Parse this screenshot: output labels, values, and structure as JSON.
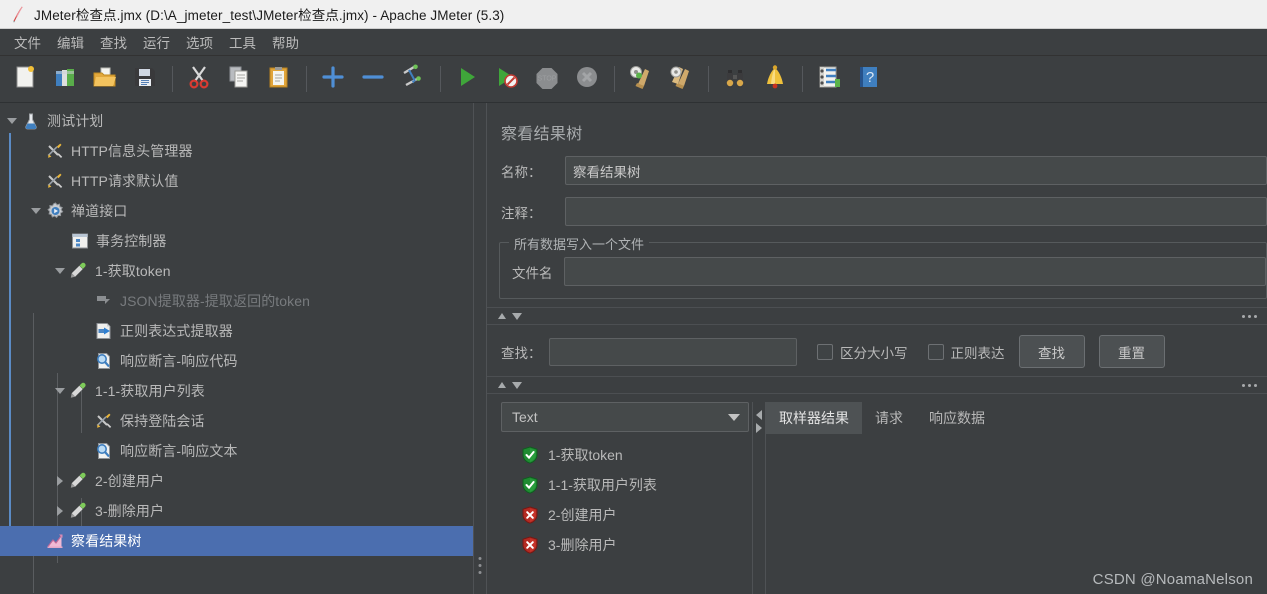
{
  "window": {
    "title": "JMeter检查点.jmx (D:\\A_jmeter_test\\JMeter检查点.jmx) - Apache JMeter (5.3)",
    "app_icon": "jmeter-feather-icon"
  },
  "menubar": {
    "items": [
      {
        "label": "文件",
        "name": "menu-file"
      },
      {
        "label": "编辑",
        "name": "menu-edit"
      },
      {
        "label": "查找",
        "name": "menu-search"
      },
      {
        "label": "运行",
        "name": "menu-run"
      },
      {
        "label": "选项",
        "name": "menu-options"
      },
      {
        "label": "工具",
        "name": "menu-tools"
      },
      {
        "label": "帮助",
        "name": "menu-help"
      }
    ]
  },
  "toolbar": {
    "buttons": [
      {
        "icon": "new-document-icon",
        "name": "new-button"
      },
      {
        "icon": "templates-icon",
        "name": "templates-button"
      },
      {
        "icon": "open-folder-icon",
        "name": "open-button"
      },
      {
        "icon": "save-floppy-icon",
        "name": "save-button"
      },
      {
        "sep": true
      },
      {
        "icon": "scissors-cut-icon",
        "name": "cut-button"
      },
      {
        "icon": "copy-pages-icon",
        "name": "copy-button"
      },
      {
        "icon": "clipboard-paste-icon",
        "name": "paste-button"
      },
      {
        "sep": true
      },
      {
        "icon": "plus-expand-icon",
        "name": "expand-all-button"
      },
      {
        "icon": "minus-collapse-icon",
        "name": "collapse-all-button"
      },
      {
        "icon": "toggle-element-icon",
        "name": "toggle-button"
      },
      {
        "sep": true
      },
      {
        "icon": "run-play-icon",
        "name": "start-button"
      },
      {
        "icon": "run-no-pauses-icon",
        "name": "start-no-pauses-button"
      },
      {
        "icon": "stop-octagon-icon",
        "name": "stop-button"
      },
      {
        "icon": "shutdown-icon",
        "name": "shutdown-button"
      },
      {
        "sep": true
      },
      {
        "icon": "clear-broom-icon",
        "name": "clear-button"
      },
      {
        "icon": "clear-all-broom-icon",
        "name": "clear-all-button"
      },
      {
        "sep": true
      },
      {
        "icon": "binoculars-search-icon",
        "name": "search-tree-button"
      },
      {
        "icon": "reset-search-bell-icon",
        "name": "reset-search-button"
      },
      {
        "sep": true
      },
      {
        "icon": "function-helper-icon",
        "name": "function-helper-button"
      },
      {
        "icon": "help-book-icon",
        "name": "help-button"
      }
    ]
  },
  "tree": {
    "nodes": [
      {
        "label": "测试计划",
        "depth": 0,
        "twisty": "down",
        "icon": "test-plan-icon",
        "state": "normal",
        "selected": false
      },
      {
        "label": "HTTP信息头管理器",
        "depth": 1,
        "twisty": "none",
        "icon": "header-manager-icon",
        "state": "normal",
        "selected": false
      },
      {
        "label": "HTTP请求默认值",
        "depth": 1,
        "twisty": "none",
        "icon": "http-defaults-icon",
        "state": "normal",
        "selected": false
      },
      {
        "label": "禅道接口",
        "depth": 1,
        "twisty": "down",
        "icon": "thread-group-icon",
        "state": "normal",
        "selected": false
      },
      {
        "label": "事务控制器",
        "depth": 2,
        "twisty": "none",
        "icon": "transaction-controller-icon",
        "state": "normal",
        "selected": false
      },
      {
        "label": "1-获取token",
        "depth": 2,
        "twisty": "down",
        "icon": "http-sampler-icon",
        "state": "normal",
        "selected": false
      },
      {
        "label": "JSON提取器-提取返回的token",
        "depth": 3,
        "twisty": "none",
        "icon": "post-processor-icon",
        "state": "disabled",
        "selected": false
      },
      {
        "label": "正则表达式提取器",
        "depth": 3,
        "twisty": "none",
        "icon": "regex-extractor-icon",
        "state": "normal",
        "selected": false
      },
      {
        "label": "响应断言-响应代码",
        "depth": 3,
        "twisty": "none",
        "icon": "assertion-icon",
        "state": "normal",
        "selected": false
      },
      {
        "label": "1-1-获取用户列表",
        "depth": 2,
        "twisty": "down",
        "icon": "http-sampler-icon",
        "state": "normal",
        "selected": false
      },
      {
        "label": "保持登陆会话",
        "depth": 3,
        "twisty": "none",
        "icon": "header-manager-icon",
        "state": "normal",
        "selected": false
      },
      {
        "label": "响应断言-响应文本",
        "depth": 3,
        "twisty": "none",
        "icon": "assertion-icon",
        "state": "normal",
        "selected": false
      },
      {
        "label": "2-创建用户",
        "depth": 2,
        "twisty": "right",
        "icon": "http-sampler-icon",
        "state": "normal",
        "selected": false
      },
      {
        "label": "3-删除用户",
        "depth": 2,
        "twisty": "right",
        "icon": "http-sampler-icon",
        "state": "normal",
        "selected": false
      },
      {
        "label": "察看结果树",
        "depth": 1,
        "twisty": "none",
        "icon": "view-results-tree-icon",
        "state": "normal",
        "selected": true
      }
    ]
  },
  "panel": {
    "title": "察看结果树",
    "name_label": "名称：",
    "name_value": "察看结果树",
    "comment_label": "注释：",
    "comment_value": "",
    "comment_placeholder": "",
    "file_group_title": "所有数据写入一个文件",
    "filename_label": "文件名",
    "filename_value": "",
    "filename_placeholder": "",
    "search": {
      "label": "查找：",
      "value": "",
      "placeholder": "",
      "case_sensitive_label": "区分大小写",
      "case_sensitive_checked": false,
      "regex_label": "正则表达",
      "regex_checked": false,
      "find_button": "查找",
      "reset_button": "重置"
    },
    "renderer": {
      "selected": "Text"
    },
    "results": [
      {
        "label": "1-获取token",
        "status": "success"
      },
      {
        "label": "1-1-获取用户列表",
        "status": "success"
      },
      {
        "label": "2-创建用户",
        "status": "failure"
      },
      {
        "label": "3-删除用户",
        "status": "failure"
      }
    ],
    "tabs": [
      {
        "label": "取样器结果",
        "active": true
      },
      {
        "label": "请求",
        "active": false
      },
      {
        "label": "响应数据",
        "active": false
      }
    ]
  },
  "watermark": "CSDN @NoamaNelson",
  "colors": {
    "bg": "#3c3f41",
    "titlebar_bg": "#f0f0f0",
    "selection_blue": "#4b6eaf",
    "guide_blue": "#5b8bc4",
    "text": "#b9b9b9",
    "text_disabled": "#787b7e",
    "success_green": "#2e9b3e",
    "failure_red": "#c4312c",
    "field_bg": "#45494a",
    "border": "#5e6163"
  }
}
